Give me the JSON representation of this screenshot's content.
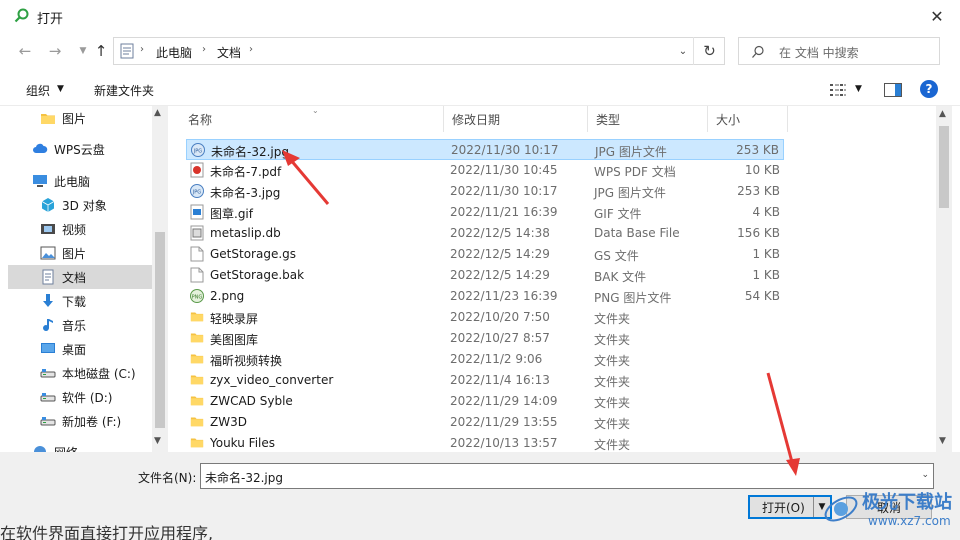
{
  "window": {
    "title": "打开",
    "close_glyph": "✕"
  },
  "address": {
    "segments": [
      "此电脑",
      "文档"
    ],
    "search_placeholder": "在 文档 中搜索"
  },
  "toolbar": {
    "organize": "组织",
    "new_folder": "新建文件夹",
    "help": "?"
  },
  "nav": {
    "items": [
      {
        "label": "图片",
        "icon": "folder-icon",
        "color": "#f5c242"
      },
      {
        "label": "WPS云盘",
        "icon": "cloud-icon",
        "color": "#2f7fe0"
      },
      {
        "label": "此电脑",
        "icon": "computer-icon",
        "color": "#3a8de0"
      },
      {
        "label": "3D 对象",
        "icon": "cube-icon",
        "color": "#29a3d9"
      },
      {
        "label": "视频",
        "icon": "film-icon",
        "color": "#4a4a4a"
      },
      {
        "label": "图片",
        "icon": "picture-icon",
        "color": "#4a90d9"
      },
      {
        "label": "文档",
        "icon": "document-icon",
        "color": "#6e7f9c",
        "selected": true
      },
      {
        "label": "下载",
        "icon": "download-icon",
        "color": "#2a7fd4"
      },
      {
        "label": "音乐",
        "icon": "music-icon",
        "color": "#2a7fd4"
      },
      {
        "label": "桌面",
        "icon": "desktop-icon",
        "color": "#2a7fd4"
      },
      {
        "label": "本地磁盘 (C:)",
        "icon": "drive-icon",
        "color": "#555555"
      },
      {
        "label": "软件 (D:)",
        "icon": "drive-icon",
        "color": "#555555"
      },
      {
        "label": "新加卷 (F:)",
        "icon": "drive-icon",
        "color": "#555555"
      },
      {
        "label": "网络",
        "icon": "network-icon",
        "color": "#4a90d9"
      }
    ]
  },
  "columns": {
    "name": "名称",
    "date": "修改日期",
    "type": "类型",
    "size": "大小"
  },
  "files": [
    {
      "name": "未命名-32.jpg",
      "date": "2022/11/30 10:17",
      "type": "JPG 图片文件",
      "size": "253 KB",
      "icon": "jpg-file-icon",
      "selected": true
    },
    {
      "name": "未命名-7.pdf",
      "date": "2022/11/30 10:45",
      "type": "WPS PDF 文档",
      "size": "10 KB",
      "icon": "pdf-file-icon"
    },
    {
      "name": "未命名-3.jpg",
      "date": "2022/11/30 10:17",
      "type": "JPG 图片文件",
      "size": "253 KB",
      "icon": "jpg-file-icon"
    },
    {
      "name": "图章.gif",
      "date": "2022/11/21 16:39",
      "type": "GIF 文件",
      "size": "4 KB",
      "icon": "gif-file-icon"
    },
    {
      "name": "metaslip.db",
      "date": "2022/12/5 14:38",
      "type": "Data Base File",
      "size": "156 KB",
      "icon": "db-file-icon"
    },
    {
      "name": "GetStorage.gs",
      "date": "2022/12/5 14:29",
      "type": "GS 文件",
      "size": "1 KB",
      "icon": "blank-file-icon"
    },
    {
      "name": "GetStorage.bak",
      "date": "2022/12/5 14:29",
      "type": "BAK 文件",
      "size": "1 KB",
      "icon": "blank-file-icon"
    },
    {
      "name": "2.png",
      "date": "2022/11/23 16:39",
      "type": "PNG 图片文件",
      "size": "54 KB",
      "icon": "png-file-icon"
    },
    {
      "name": "轻映录屏",
      "date": "2022/10/20 7:50",
      "type": "文件夹",
      "size": "",
      "icon": "folder-icon"
    },
    {
      "name": "美图图库",
      "date": "2022/10/27 8:57",
      "type": "文件夹",
      "size": "",
      "icon": "folder-icon"
    },
    {
      "name": "福昕视频转换",
      "date": "2022/11/2 9:06",
      "type": "文件夹",
      "size": "",
      "icon": "folder-icon"
    },
    {
      "name": "zyx_video_converter",
      "date": "2022/11/4 16:13",
      "type": "文件夹",
      "size": "",
      "icon": "folder-icon"
    },
    {
      "name": "ZWCAD Syble",
      "date": "2022/11/29 14:09",
      "type": "文件夹",
      "size": "",
      "icon": "folder-icon"
    },
    {
      "name": "ZW3D",
      "date": "2022/11/29 13:55",
      "type": "文件夹",
      "size": "",
      "icon": "folder-icon"
    },
    {
      "name": "Youku Files",
      "date": "2022/10/13 13:57",
      "type": "文件夹",
      "size": "",
      "icon": "folder-icon"
    }
  ],
  "bottom": {
    "filename_label": "文件名(N):",
    "filename_value": "未命名-32.jpg",
    "open_label": "打开(O)",
    "cancel_label": "取消"
  },
  "background_text": "在软件界面直接打开应用程序,",
  "watermark": {
    "line1": "极光下载站",
    "line2": "www.xz7.com"
  },
  "colors": {
    "accent": "#0078d7",
    "selection": "#cce8ff",
    "annotation": "#e53935"
  }
}
